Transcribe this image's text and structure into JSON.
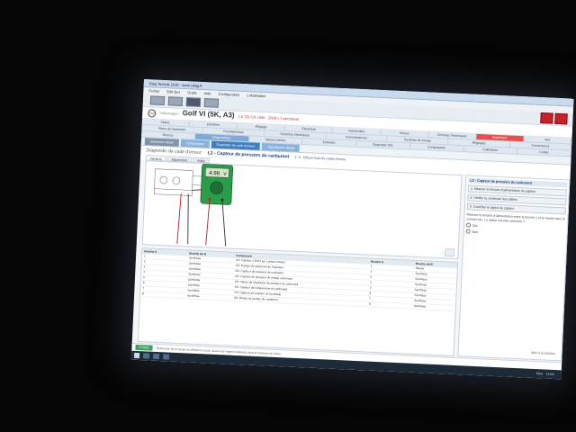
{
  "window": {
    "title": "Diag Technik 2016 - www.cdiag.fr",
    "menu": [
      "Fichier",
      "Edit Bus",
      "Outils",
      "Aide",
      "Configuration",
      "Lokalisation"
    ]
  },
  "vehicle": {
    "brand": "Volkswagen",
    "model": "Golf VI (5K, A3)",
    "details": "1.6 TDI CR 1598 - 2008 > Turbodiesel"
  },
  "nav": {
    "row1": [
      "Sélect.",
      "Entretien",
      "Réglage",
      "Électrique",
      "Intervention",
      "Pièces",
      "Données Techniques",
      "Répertoire",
      "Mot"
    ],
    "row2": [
      "Plans de réparation",
      "Fusibles/relais",
      "Schémas électriques",
      "Connaissances",
      "Système de charge",
      "Réglages",
      "Connecteurs"
    ],
    "row3": [
      "Bornes",
      "Diagnostique",
      "Valeurs réelles",
      "Entretien",
      "Diagnostic MIL",
      "Composants",
      "Calibration",
      "Codes"
    ]
  },
  "tabs": [
    {
      "label": "Sommaire diesel",
      "style": "normal"
    },
    {
      "label": "Composants",
      "style": "light"
    },
    {
      "label": "Diagnostic de code d'erreur",
      "style": "active"
    },
    {
      "label": "Signalisation diesel",
      "style": "light"
    }
  ],
  "page": {
    "heading": "Diagnostic de code d'erreur:",
    "component": "L2 - Capteur de pression du carburant",
    "step": "1 / 3 - Effacer tous les codes d'erreur"
  },
  "subtabs": [
    "Général",
    "Alignement",
    "Vidéo"
  ],
  "table": {
    "headers": [
      "Broche A",
      "Broche de B",
      "Composant",
      "Broche A",
      "Broche de B"
    ],
    "rows": [
      [
        "1",
        "Synthèse",
        "SS: Capteur 1 EGO sur contact moteur",
        "1",
        "Masse"
      ],
      [
        "2",
        "Synthèse",
        "SS: Pompe de carburant de l'injecteur",
        "2",
        "Synthèse"
      ],
      [
        "3",
        "Synthèse",
        "SS: Capteur de pression de carburant",
        "5",
        "Synthèse"
      ],
      [
        "4",
        "Synthèse",
        "SS: Capteur de pression de rampe commune",
        "4",
        "Synthèse"
      ],
      [
        "5",
        "Synthèse",
        "SS: Vanne de régulation de pression du carburant",
        "3",
        "Synthèse"
      ],
      [
        "6",
        "Synthèse",
        "SS: Capteur de température du carburant",
        "6",
        "Synthèse"
      ],
      [
        "7",
        "Synthèse",
        "SS: Capteur de position de la pédale",
        "7",
        "Synthèse"
      ],
      [
        "8",
        "Synthèse",
        "SS: Relais de pompe de carburant",
        "8",
        "Synthèse"
      ]
    ]
  },
  "panel": {
    "title": "L2 - Capteur de pression du carburant",
    "buttons": [
      "1. Mesurer la tension d'alimentation du capteur",
      "2. Vérifier la continuité des câbles",
      "3. Contrôler le signal du capteur"
    ],
    "question": "Mesurer la tension d'alimentation entre la broche 1 et la masse avec le contact mis. La valeur est-elle conforme ?",
    "options": [
      "Oui",
      "Non"
    ],
    "footer": "Aller à la solution"
  },
  "multimeter": {
    "reading": "4.98",
    "unit": "V"
  },
  "status": {
    "button": "ÉTAPE",
    "text": "Recherche de la cause du défaut en cours. Suivre les étapes indiquées dans le panneau de droite."
  },
  "taskbar": {
    "lang": "FRA",
    "time": "15:44"
  },
  "colors": {
    "accent": "#3d7fc1",
    "alert": "#e45050",
    "meter": "#2a9d4a"
  }
}
